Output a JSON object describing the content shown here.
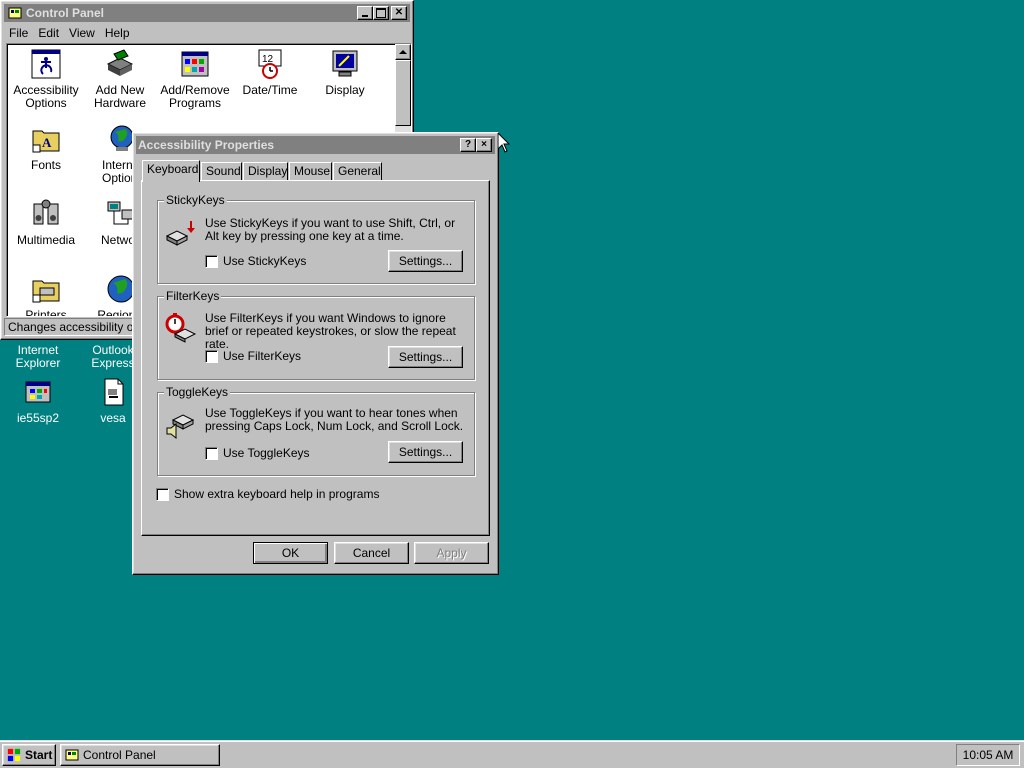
{
  "control_panel": {
    "title": "Control Panel",
    "menu": [
      "File",
      "Edit",
      "View",
      "Help"
    ],
    "items": [
      {
        "label": "Accessibility Options",
        "icon": "accessibility-icon"
      },
      {
        "label": "Add New Hardware",
        "icon": "hardware-icon"
      },
      {
        "label": "Add/Remove Programs",
        "icon": "programs-icon"
      },
      {
        "label": "Date/Time",
        "icon": "clock-icon"
      },
      {
        "label": "Display",
        "icon": "display-icon"
      },
      {
        "label": "Fonts",
        "icon": "fonts-folder-icon"
      },
      {
        "label": "Internet Options",
        "icon": "internet-icon"
      },
      {
        "label": "Multimedia",
        "icon": "multimedia-icon"
      },
      {
        "label": "Network",
        "icon": "network-icon"
      },
      {
        "label": "Printers",
        "icon": "printers-folder-icon"
      },
      {
        "label": "Regional",
        "icon": "globe-icon"
      }
    ],
    "status": "Changes accessibility options"
  },
  "desktop": {
    "items": [
      {
        "label": "Internet Explorer",
        "icon": "ie-icon"
      },
      {
        "label": "Outlook Express",
        "icon": "outlook-icon"
      },
      {
        "label": "ie55sp2",
        "icon": "setup-icon"
      },
      {
        "label": "vesa",
        "icon": "document-icon"
      }
    ]
  },
  "dialog": {
    "title": "Accessibility Properties",
    "help_glyph": "?",
    "close_glyph": "×",
    "tabs": [
      "Keyboard",
      "Sound",
      "Display",
      "Mouse",
      "General"
    ],
    "sticky": {
      "group": "StickyKeys",
      "desc": "Use StickyKeys if you want to use Shift, Ctrl, or Alt key by pressing one key at a time.",
      "check": "Use StickyKeys",
      "settings": "Settings..."
    },
    "filter": {
      "group": "FilterKeys",
      "desc": "Use FilterKeys if you want Windows to ignore brief or repeated keystrokes, or slow the repeat rate.",
      "check": "Use FilterKeys",
      "settings": "Settings..."
    },
    "toggle": {
      "group": "ToggleKeys",
      "desc": "Use ToggleKeys if you want to hear tones when pressing Caps Lock, Num Lock, and Scroll Lock.",
      "check": "Use ToggleKeys",
      "settings": "Settings..."
    },
    "extra_help": "Show extra keyboard help in programs",
    "ok": "OK",
    "cancel": "Cancel",
    "apply": "Apply"
  },
  "taskbar": {
    "start": "Start",
    "task": "Control Panel",
    "clock": "10:05 AM"
  },
  "colors": {
    "desktop": "#008080",
    "title_active": "#000080",
    "title_inactive": "#808080",
    "face": "#c0c0c0"
  }
}
